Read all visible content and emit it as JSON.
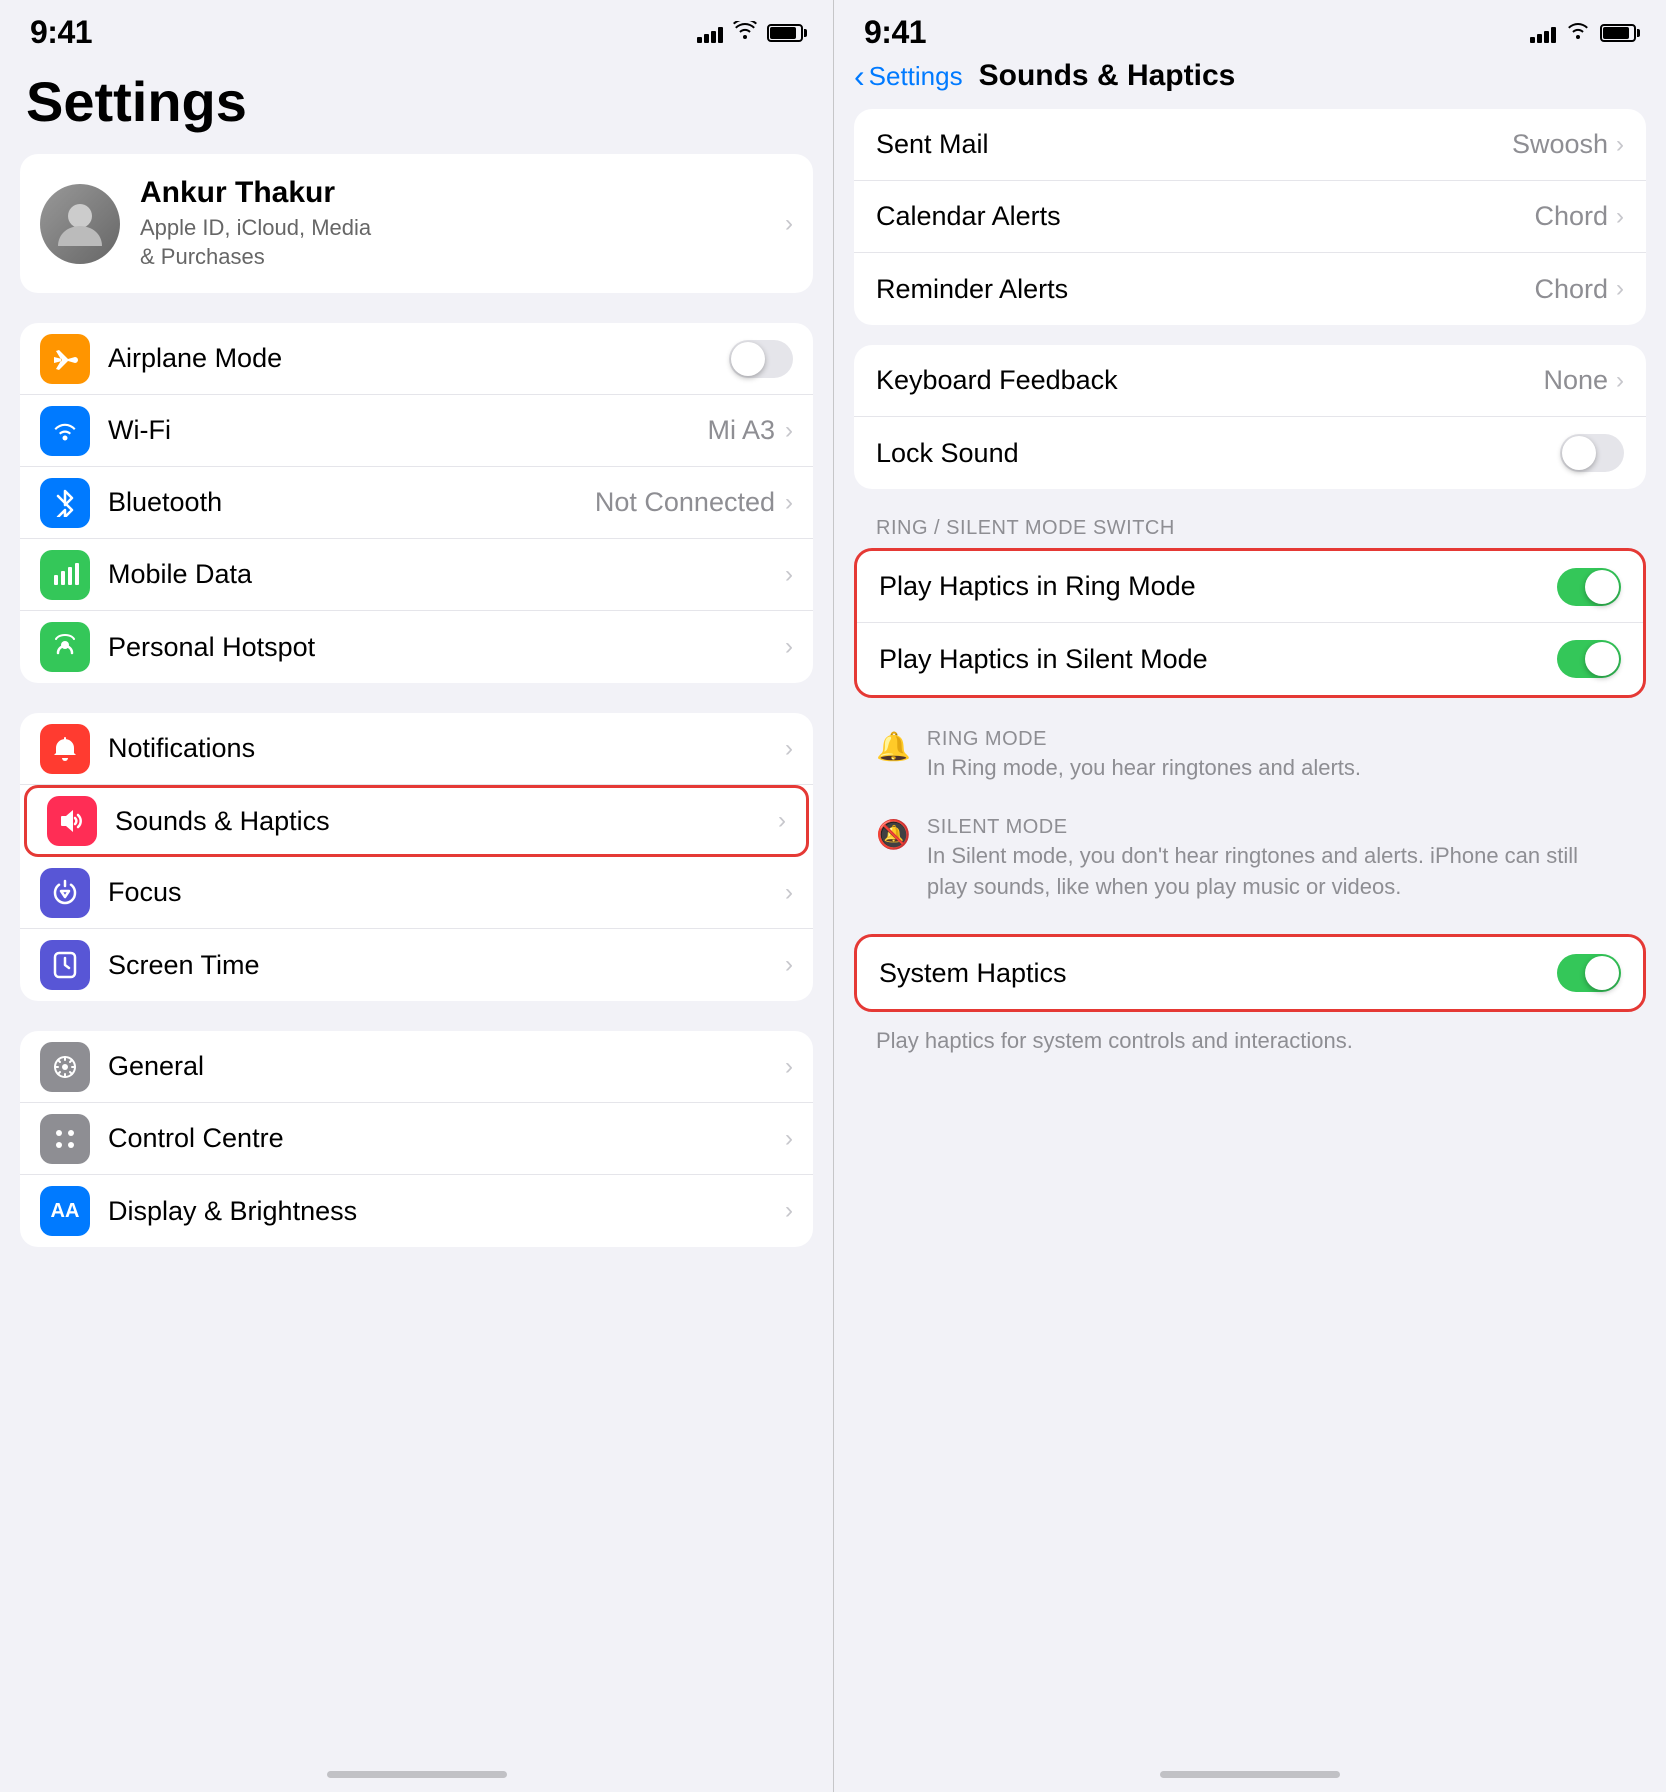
{
  "left": {
    "status": {
      "time": "9:41"
    },
    "title": "Settings",
    "profile": {
      "name": "Ankur Thakur",
      "subtitle": "Apple ID, iCloud, Media\n& Purchases"
    },
    "group1": {
      "items": [
        {
          "id": "airplane-mode",
          "label": "Airplane Mode",
          "iconBg": "icon-orange",
          "iconSymbol": "✈",
          "type": "toggle",
          "toggleOn": false
        },
        {
          "id": "wifi",
          "label": "Wi-Fi",
          "iconBg": "icon-blue",
          "iconSymbol": "wifi",
          "type": "value",
          "value": "Mi A3"
        },
        {
          "id": "bluetooth",
          "label": "Bluetooth",
          "iconBg": "icon-blue-dark",
          "iconSymbol": "bluetooth",
          "type": "value",
          "value": "Not Connected"
        },
        {
          "id": "mobile-data",
          "label": "Mobile Data",
          "iconBg": "icon-green",
          "iconSymbol": "antenna",
          "type": "chevron"
        },
        {
          "id": "personal-hotspot",
          "label": "Personal Hotspot",
          "iconBg": "icon-green2",
          "iconSymbol": "hotspot",
          "type": "chevron"
        }
      ]
    },
    "group2": {
      "items": [
        {
          "id": "notifications",
          "label": "Notifications",
          "iconBg": "icon-red",
          "iconSymbol": "bell",
          "type": "chevron"
        },
        {
          "id": "sounds-haptics",
          "label": "Sounds & Haptics",
          "iconBg": "icon-pink",
          "iconSymbol": "speaker",
          "type": "chevron",
          "highlighted": true
        },
        {
          "id": "focus",
          "label": "Focus",
          "iconBg": "icon-purple",
          "iconSymbol": "moon",
          "type": "chevron"
        },
        {
          "id": "screen-time",
          "label": "Screen Time",
          "iconBg": "icon-purple2",
          "iconSymbol": "hourglass",
          "type": "chevron"
        }
      ]
    },
    "group3": {
      "items": [
        {
          "id": "general",
          "label": "General",
          "iconBg": "icon-gray",
          "iconSymbol": "gear",
          "type": "chevron"
        },
        {
          "id": "control-centre",
          "label": "Control Centre",
          "iconBg": "icon-gray2",
          "iconSymbol": "sliders",
          "type": "chevron"
        },
        {
          "id": "display-brightness",
          "label": "Display & Brightness",
          "iconBg": "icon-blue2",
          "iconSymbol": "AA",
          "type": "chevron"
        }
      ]
    }
  },
  "right": {
    "status": {
      "time": "9:41"
    },
    "nav": {
      "back_label": "Settings",
      "title": "Sounds & Haptics"
    },
    "group1": {
      "items": [
        {
          "id": "sent-mail",
          "label": "Sent Mail",
          "value": "Swoosh",
          "type": "value"
        },
        {
          "id": "calendar-alerts",
          "label": "Calendar Alerts",
          "value": "Chord",
          "type": "value"
        },
        {
          "id": "reminder-alerts",
          "label": "Reminder Alerts",
          "value": "Chord",
          "type": "value"
        }
      ]
    },
    "group2": {
      "items": [
        {
          "id": "keyboard-feedback",
          "label": "Keyboard Feedback",
          "value": "None",
          "type": "value"
        },
        {
          "id": "lock-sound",
          "label": "Lock Sound",
          "type": "toggle",
          "toggleOn": false
        }
      ]
    },
    "ring_section_label": "RING / SILENT MODE SWITCH",
    "group3_highlighted": {
      "items": [
        {
          "id": "haptics-ring",
          "label": "Play Haptics in Ring Mode",
          "type": "toggle",
          "toggleOn": true
        },
        {
          "id": "haptics-silent",
          "label": "Play Haptics in Silent Mode",
          "type": "toggle",
          "toggleOn": true
        }
      ]
    },
    "ring_mode": {
      "icon": "🔔",
      "title": "RING MODE",
      "desc": "In Ring mode, you hear ringtones and alerts."
    },
    "silent_mode": {
      "icon": "🔕",
      "title": "SILENT MODE",
      "desc": "In Silent mode, you don't hear ringtones and alerts. iPhone can still play sounds, like when you play music or videos."
    },
    "system_haptics": {
      "label": "System Haptics",
      "toggleOn": true,
      "desc": "Play haptics for system controls and interactions."
    }
  },
  "icons": {
    "chevron": "›",
    "back_chevron": "‹"
  }
}
